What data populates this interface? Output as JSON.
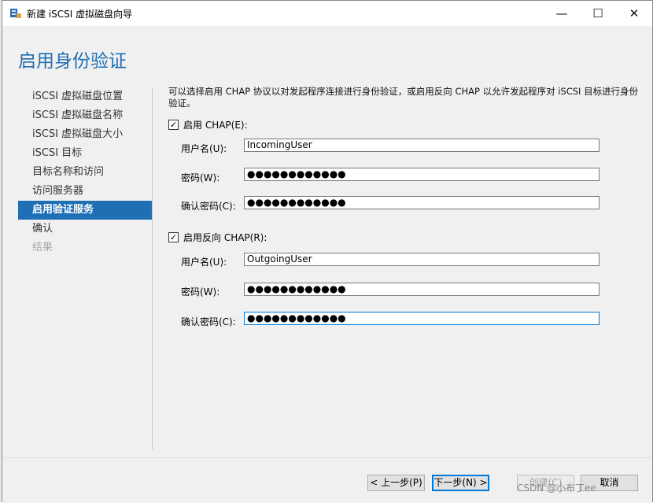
{
  "window": {
    "title": "新建 iSCSI 虚拟磁盘向导",
    "minimize": "—",
    "maximize": "☐",
    "close": "✕"
  },
  "header": {
    "heading": "启用身份验证"
  },
  "nav": {
    "items": [
      {
        "label": "iSCSI 虚拟磁盘位置",
        "state": "normal"
      },
      {
        "label": "iSCSI 虚拟磁盘名称",
        "state": "normal"
      },
      {
        "label": "iSCSI 虚拟磁盘大小",
        "state": "normal"
      },
      {
        "label": "iSCSI 目标",
        "state": "normal"
      },
      {
        "label": "目标名称和访问",
        "state": "normal"
      },
      {
        "label": "访问服务器",
        "state": "normal"
      },
      {
        "label": "启用验证服务",
        "state": "active"
      },
      {
        "label": "确认",
        "state": "normal"
      },
      {
        "label": "结果",
        "state": "disabled"
      }
    ]
  },
  "content": {
    "description": "可以选择启用 CHAP 协议以对发起程序连接进行身份验证，或启用反向 CHAP 以允许发起程序对 iSCSI 目标进行身份验证。",
    "chap": {
      "checkbox_label": "启用 CHAP(E):",
      "checked": true,
      "username_label": "用户名(U):",
      "username_value": "IncomingUser",
      "password_label": "密码(W):",
      "password_value": "●●●●●●●●●●●●",
      "confirm_label": "确认密码(C):",
      "confirm_value": "●●●●●●●●●●●●"
    },
    "reverse_chap": {
      "checkbox_label": "启用反向 CHAP(R):",
      "checked": true,
      "username_label": "用户名(U):",
      "username_value": "OutgoingUser",
      "password_label": "密码(W):",
      "password_value": "●●●●●●●●●●●●",
      "confirm_label": "确认密码(C):",
      "confirm_value": "●●●●●●●●●●●●"
    },
    "check_mark": "✓"
  },
  "footer": {
    "prev": "< 上一步(P)",
    "next": "下一步(N) >",
    "create": "创建(C)",
    "cancel": "取消"
  },
  "watermark": "CSDN @小布丁ee",
  "colors": {
    "accent": "#1e6eb4",
    "selected_bg": "#1f6fb5",
    "focus_border": "#0078d7"
  }
}
